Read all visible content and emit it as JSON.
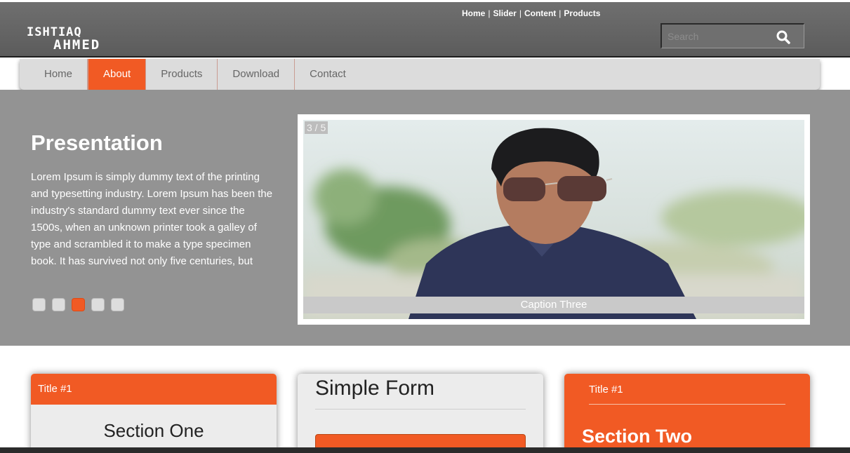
{
  "header": {
    "logo_line1": "ISHTIAQ",
    "logo_line2": "AHMED",
    "top_links": [
      "Home",
      "Slider",
      "Content",
      "Products"
    ],
    "search_placeholder": "Search"
  },
  "nav": {
    "items": [
      {
        "label": "Home",
        "active": false
      },
      {
        "label": "About",
        "active": true
      },
      {
        "label": "Products",
        "active": false
      },
      {
        "label": "Download",
        "active": false
      },
      {
        "label": "Contact",
        "active": false
      }
    ]
  },
  "hero": {
    "title": "Presentation",
    "body": "Lorem Ipsum is simply dummy text of the printing and typesetting industry. Lorem Ipsum has been the industry's standard dummy text ever since the 1500s, when an unknown printer took a galley of type and scrambled it to make a type specimen book. It has survived not only five centuries, but",
    "slide_counter": "3 / 5",
    "slide_caption": "Caption Three",
    "active_dot": 3,
    "dot_count": 5
  },
  "cards": {
    "card1": {
      "header": "Title #1",
      "title": "Section One"
    },
    "card2": {
      "title": "Simple Form"
    },
    "card3": {
      "header": "Title #1",
      "title": "Section Two"
    }
  },
  "colors": {
    "accent": "#f15a24",
    "header_bg": "#666666",
    "hero_bg": "#939393",
    "nav_bg": "#dcdcdc"
  }
}
